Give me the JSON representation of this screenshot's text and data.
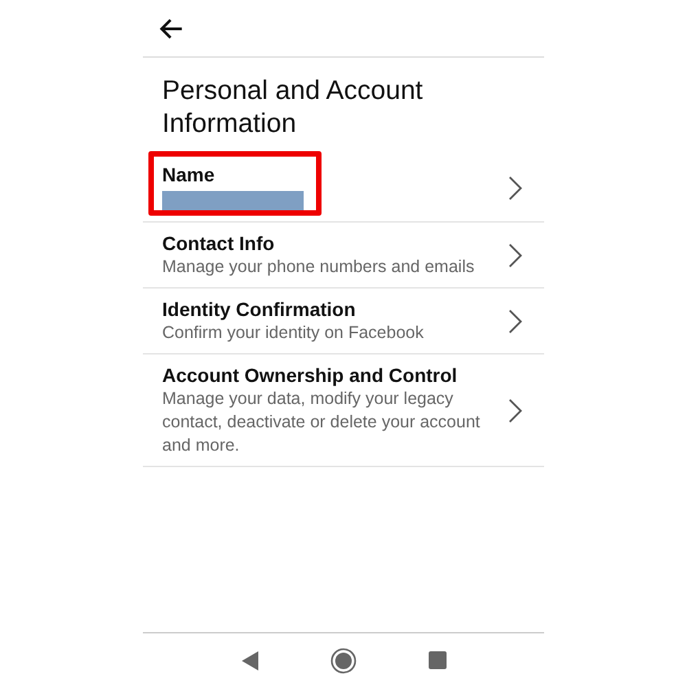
{
  "title": "Personal and Account Information",
  "items": [
    {
      "label": "Name",
      "value_hidden": true,
      "highlighted": true
    },
    {
      "label": "Contact Info",
      "subtitle": "Manage your phone numbers and emails",
      "value_hidden": false,
      "highlighted": false
    },
    {
      "label": "Identity Confirmation",
      "subtitle": "Confirm your identity on Facebook",
      "value_hidden": false,
      "highlighted": false
    },
    {
      "label": "Account Ownership and Control",
      "subtitle": "Manage your data, modify your legacy contact, deactivate or delete your account and more.",
      "value_hidden": false,
      "highlighted": false
    }
  ]
}
